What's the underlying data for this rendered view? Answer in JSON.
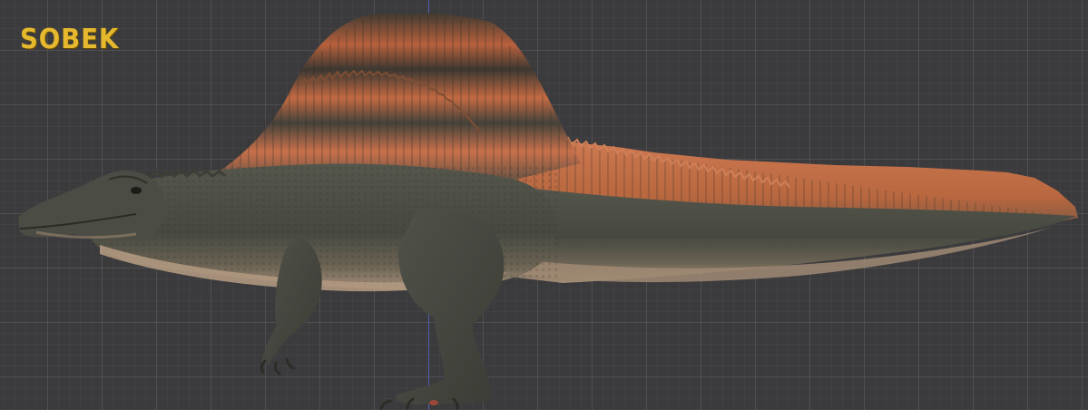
{
  "viewport": {
    "title": "SOBEK",
    "colors": {
      "background": "#3b3b3d",
      "grid": "#5a5a5c",
      "axis": "#4f63c9",
      "title": "#e5b82e",
      "skin": "#4a4c44",
      "sail_orange": "#c0643d",
      "sail_dark": "#3e3a33",
      "belly": "#a88e76"
    },
    "model": {
      "icon": "spinosaurus-model"
    }
  }
}
